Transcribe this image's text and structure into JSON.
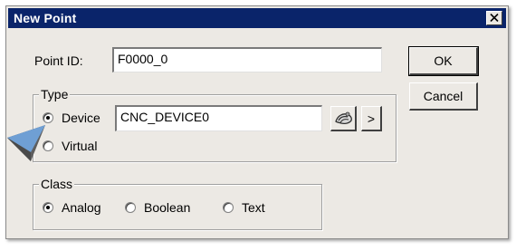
{
  "dialog": {
    "title": "New Point",
    "close_icon": "close-icon"
  },
  "point_id": {
    "label": "Point ID:",
    "value": "F0000_0"
  },
  "buttons": {
    "ok": "OK",
    "cancel": "Cancel",
    "browse_icon": "browse-device-icon",
    "more": ">"
  },
  "type_group": {
    "title": "Type",
    "options": [
      {
        "label": "Device",
        "selected": true
      },
      {
        "label": "Virtual",
        "selected": false
      }
    ],
    "device_value": "CNC_DEVICE0"
  },
  "class_group": {
    "title": "Class",
    "options": [
      {
        "label": "Analog",
        "selected": true
      },
      {
        "label": "Boolean",
        "selected": false
      },
      {
        "label": "Text",
        "selected": false
      }
    ]
  },
  "colors": {
    "titlebar": "#0a246a",
    "dialog_bg": "#ece9e4",
    "pointer": "#6f9fd4"
  },
  "annotation": {
    "pointer_icon": "pointer-arrow-icon"
  }
}
